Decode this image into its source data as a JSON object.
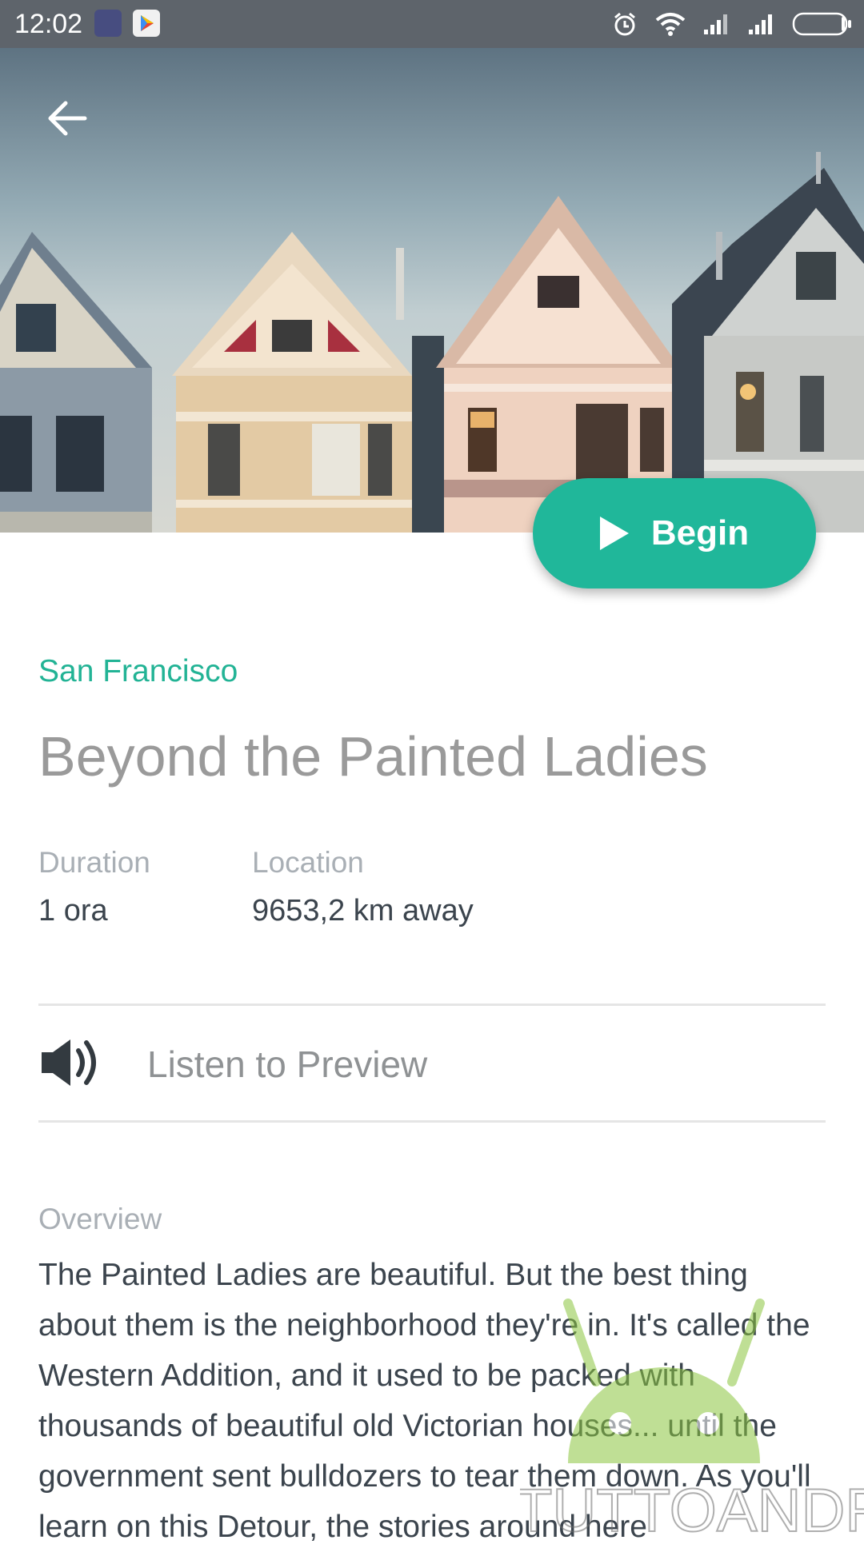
{
  "status_bar": {
    "time": "12:02",
    "icons": [
      "notification-app-icon",
      "play-store-icon",
      "alarm-icon",
      "wifi-icon",
      "signal-icon",
      "signal-icon",
      "battery-icon"
    ]
  },
  "hero": {
    "back_icon": "arrow-left-icon",
    "begin_label": "Begin",
    "begin_icon": "play-icon"
  },
  "tour": {
    "city": "San Francisco",
    "title": "Beyond the Painted Ladies",
    "duration_label": "Duration",
    "duration_value": "1 ora",
    "location_label": "Location",
    "location_value": "9653,2 km away"
  },
  "preview": {
    "label": "Listen to Preview",
    "icon": "speaker-icon"
  },
  "overview": {
    "label": "Overview",
    "text": "The Painted Ladies are beautiful. But the best thing about them is the neighborhood they're in. It's called the Western Addition, and it used to be packed with thousands of beautiful old Victorian houses... until the government sent bulldozers to tear them down. As you'll learn on this Detour, the stories around here"
  },
  "watermark": {
    "text": "TUTTOANDROID"
  },
  "colors": {
    "accent": "#20b79a",
    "status_bar": "#5e646b"
  }
}
